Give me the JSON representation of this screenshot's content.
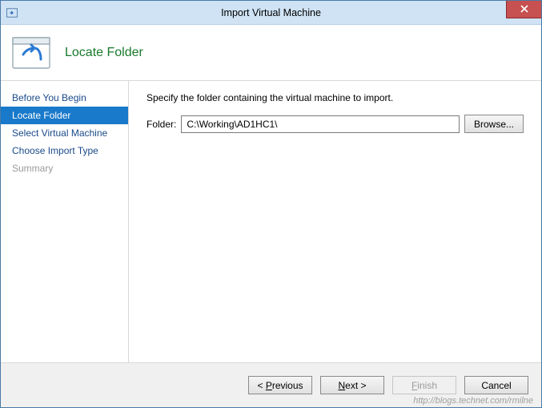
{
  "window": {
    "title": "Import Virtual Machine"
  },
  "header": {
    "title": "Locate Folder"
  },
  "sidebar": {
    "items": [
      {
        "label": "Before You Begin",
        "state": "normal"
      },
      {
        "label": "Locate Folder",
        "state": "selected"
      },
      {
        "label": "Select Virtual Machine",
        "state": "normal"
      },
      {
        "label": "Choose Import Type",
        "state": "normal"
      },
      {
        "label": "Summary",
        "state": "disabled"
      }
    ]
  },
  "content": {
    "instruction": "Specify the folder containing the virtual machine to import.",
    "folder_label": "Folder:",
    "folder_value": "C:\\Working\\AD1HC1\\",
    "browse_label": "Browse..."
  },
  "footer": {
    "previous": "< Previous",
    "next": "Next >",
    "finish": "Finish",
    "cancel": "Cancel"
  },
  "watermark": "http://blogs.technet.com/rmilne"
}
